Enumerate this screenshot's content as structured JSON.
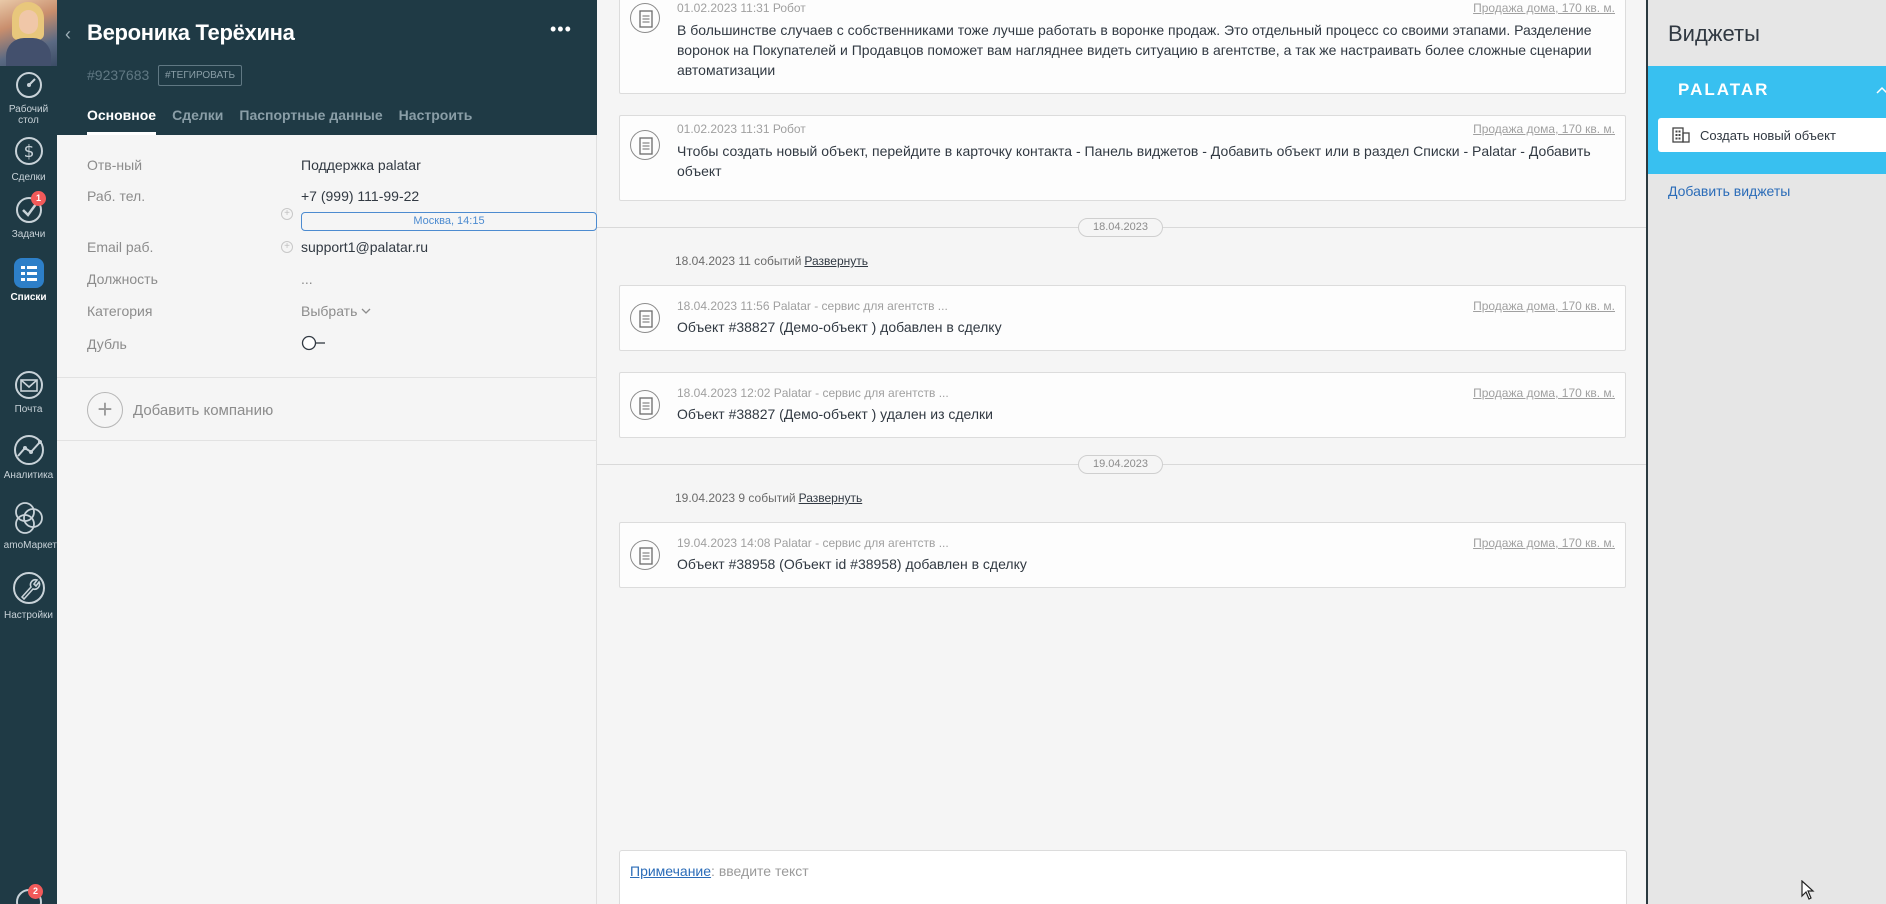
{
  "nav": {
    "items": [
      {
        "label": "Рабочий стол",
        "icon": "dashboard-icon"
      },
      {
        "label": "Сделки",
        "icon": "dollar-icon"
      },
      {
        "label": "Задачи",
        "icon": "check-icon",
        "badge": "1"
      },
      {
        "label": "Списки",
        "icon": "lists-icon",
        "active": true
      },
      {
        "label": "Почта",
        "icon": "mail-icon"
      },
      {
        "label": "Аналитика",
        "icon": "analytics-icon"
      },
      {
        "label": "amoМаркет",
        "icon": "market-icon"
      },
      {
        "label": "Настройки",
        "icon": "wrench-icon"
      }
    ],
    "bottom_badge": "2"
  },
  "card": {
    "name": "Вероника Терёхина",
    "id": "#9237683",
    "tag_button": "#ТЕГИРОВАТЬ",
    "tabs": [
      "Основное",
      "Сделки",
      "Паспортные данные",
      "Настроить"
    ],
    "active_tab": "Основное",
    "fields": {
      "responsible_label": "Отв-ный",
      "responsible_value": "Поддержка palatar",
      "phone_label": "Раб. тел.",
      "phone_value": "+7 (999) 111-99-22",
      "phone_hint": "Москва, 14:15",
      "email_label": "Email раб.",
      "email_value": "support1@palatar.ru",
      "position_label": "Должность",
      "position_value": "...",
      "category_label": "Категория",
      "category_value": "Выбрать",
      "duplicate_label": "Дубль"
    },
    "add_company": "Добавить компанию"
  },
  "feed": {
    "notes": [
      {
        "meta": "01.02.2023 11:31 Робот",
        "link": "Продажа дома, 170 кв. м.",
        "text": "В большинстве случаев с собственниками тоже лучше работать в воронке продаж. Это отдельный процесс со своими этапами. Разделение воронок на Покупателей и Продавцов поможет вам нагляднее видеть ситуацию в агентстве, а так же настраивать более сложные сценарии автоматизации"
      },
      {
        "meta": "01.02.2023 11:31 Робот",
        "link": "Продажа дома, 170 кв. м.",
        "text": "Чтобы создать новый объект, перейдите в карточку контакта - Панель виджетов - Добавить объект или в раздел Списки - Palatar - Добавить объект"
      },
      {
        "meta": "18.04.2023 11:56 Palatar - сервис для агентств ...",
        "link": "Продажа дома, 170 кв. м.",
        "text": "Объект #38827 (Демо-объект ) добавлен в сделку"
      },
      {
        "meta": "18.04.2023 12:02 Palatar - сервис для агентств ...",
        "link": "Продажа дома, 170 кв. м.",
        "text": "Объект #38827 (Демо-объект ) удален из сделки"
      },
      {
        "meta": "19.04.2023 14:08 Palatar - сервис для агентств ...",
        "link": "Продажа дома, 170 кв. м.",
        "text": "Объект #38958 (Объект id #38958) добавлен в сделку"
      }
    ],
    "separators": [
      "18.04.2023",
      "19.04.2023"
    ],
    "summaries": [
      {
        "text": "18.04.2023 11 событий",
        "expand": "Развернуть"
      },
      {
        "text": "19.04.2023 9 событий",
        "expand": "Развернуть"
      }
    ],
    "composer": {
      "type_label": "Примечание",
      "placeholder": ": введите текст"
    }
  },
  "widgets": {
    "title": "Виджеты",
    "palatar_logo": "PALATAR",
    "create_object": "Создать новый объект",
    "add_widgets": "Добавить виджеты"
  },
  "colors": {
    "sidebar_bg": "#1f3a45",
    "accent_blue": "#2b6cb8",
    "palatar_blue": "#38c0f0",
    "badge_red": "#f25a5a"
  }
}
